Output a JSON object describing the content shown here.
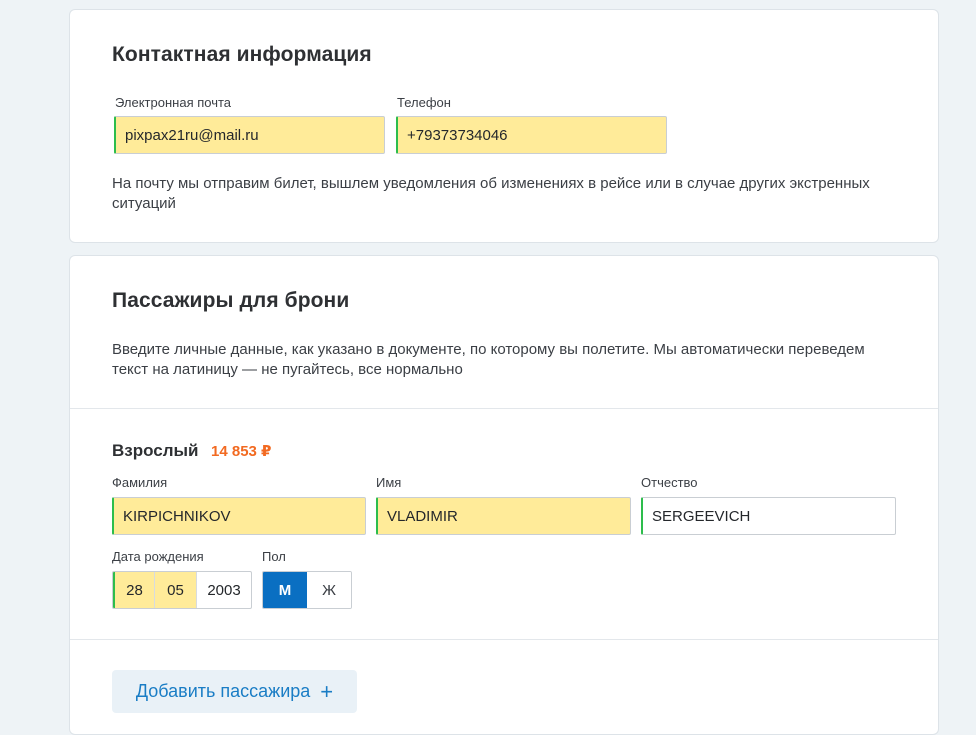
{
  "contact": {
    "title": "Контактная информация",
    "email_label": "Электронная почта",
    "email_value": "pixpax21ru@mail.ru",
    "phone_label": "Телефон",
    "phone_value": "+79373734046",
    "hint": "На почту мы отправим билет, вышлем уведомления об изменениях в рейсе или в случае других экстренных ситуаций"
  },
  "passengers": {
    "title": "Пассажиры для брони",
    "hint": "Введите личные данные, как указано в документе, по которому вы полетите. Мы автоматически переведем текст на латиницу — не пугайтесь, все нормально",
    "passenger": {
      "type": "Взрослый",
      "price": "14 853 ₽",
      "surname_label": "Фамилия",
      "surname_value": "KIRPICHNIKOV",
      "name_label": "Имя",
      "name_value": "VLADIMIR",
      "patronymic_label": "Отчество",
      "patronymic_value": "SERGEEVICH",
      "birthdate_label": "Дата рождения",
      "birth_day": "28",
      "birth_month": "05",
      "birth_year": "2003",
      "gender_label": "Пол",
      "gender_male": "М",
      "gender_female": "Ж",
      "gender_selected": "М"
    },
    "add_button_label": "Добавить пассажира",
    "add_icon": "+"
  },
  "colors": {
    "filled_field": "#ffeb99",
    "valid_border": "#2dbd4c",
    "price": "#f26a21",
    "accent": "#0a6fc2"
  }
}
